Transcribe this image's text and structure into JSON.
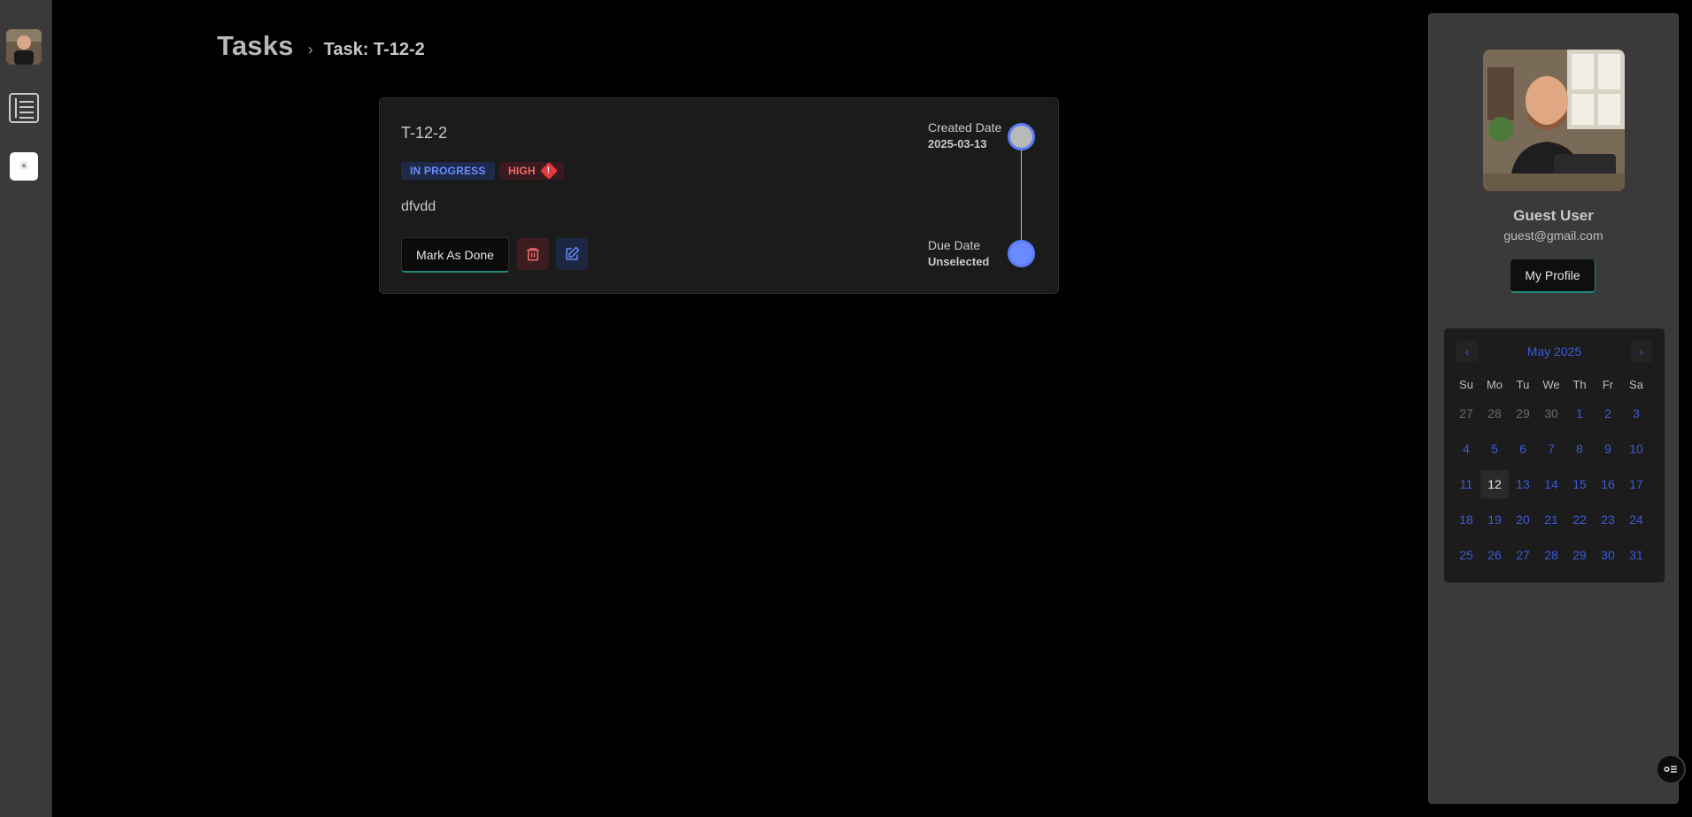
{
  "header": {
    "title": "Tasks",
    "separator": "›",
    "subtitle": "Task: T-12-2"
  },
  "task": {
    "id": "T-12-2",
    "status": "IN PROGRESS",
    "priority": "HIGH",
    "priority_icon": "!",
    "description": "dfvdd",
    "mark_done_label": "Mark As Done",
    "created_label": "Created Date",
    "created_value": "2025-03-13",
    "due_label": "Due Date",
    "due_value": "Unselected"
  },
  "profile": {
    "name": "Guest User",
    "email": "guest@gmail.com",
    "button_label": "My Profile"
  },
  "calendar": {
    "month_label": "May 2025",
    "prev": "‹",
    "next": "›",
    "weekdays": [
      "Su",
      "Mo",
      "Tu",
      "We",
      "Th",
      "Fr",
      "Sa"
    ],
    "days": [
      [
        "27",
        "28",
        "29",
        "30",
        "1",
        "2",
        "3"
      ],
      [
        "4",
        "5",
        "6",
        "7",
        "8",
        "9",
        "10"
      ],
      [
        "11",
        "12",
        "13",
        "14",
        "15",
        "16",
        "17"
      ],
      [
        "18",
        "19",
        "20",
        "21",
        "22",
        "23",
        "24"
      ],
      [
        "25",
        "26",
        "27",
        "28",
        "29",
        "30",
        "31"
      ]
    ],
    "today": "12"
  },
  "colors": {
    "accent": "#5b7cf7",
    "status_bg": "#1e2a4a",
    "priority_color": "#f16a6a"
  },
  "icons": {
    "rail": [
      "avatar",
      "list-icon",
      "sun-icon"
    ],
    "card": [
      "trash-icon",
      "edit-icon",
      "warning-icon"
    ],
    "fab": "task-list-icon"
  }
}
